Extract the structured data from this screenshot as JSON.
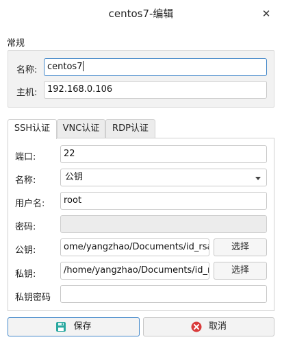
{
  "window": {
    "title": "centos7-编辑"
  },
  "general": {
    "section_label": "常规",
    "name_label": "名称:",
    "name_value": "centos7",
    "host_label": "主机:",
    "host_value": "192.168.0.106"
  },
  "tabs": [
    {
      "label": "SSH认证",
      "active": true
    },
    {
      "label": "VNC认证",
      "active": false
    },
    {
      "label": "RDP认证",
      "active": false
    }
  ],
  "ssh": {
    "port_label": "端口:",
    "port_value": "22",
    "auth_label": "名称:",
    "auth_value": "公钥",
    "user_label": "用户名:",
    "user_value": "root",
    "password_label": "密码:",
    "password_value": "",
    "pubkey_label": "公钥:",
    "pubkey_value": "ome/yangzhao/Documents/id_rsa.pub",
    "pubkey_button": "选择",
    "privkey_label": "私钥:",
    "privkey_value": "/home/yangzhao/Documents/id_rsa",
    "privkey_button": "选择",
    "passphrase_label": "私钥密码",
    "passphrase_value": ""
  },
  "buttons": {
    "save": "保存",
    "cancel": "取消"
  },
  "icons": {
    "close": "close-icon",
    "save": "floppy-disk-icon",
    "cancel": "cancel-circle-icon"
  },
  "colors": {
    "focus_border": "#3f85c8",
    "save_icon": "#2aa8a0",
    "cancel_icon": "#d93b3b"
  }
}
